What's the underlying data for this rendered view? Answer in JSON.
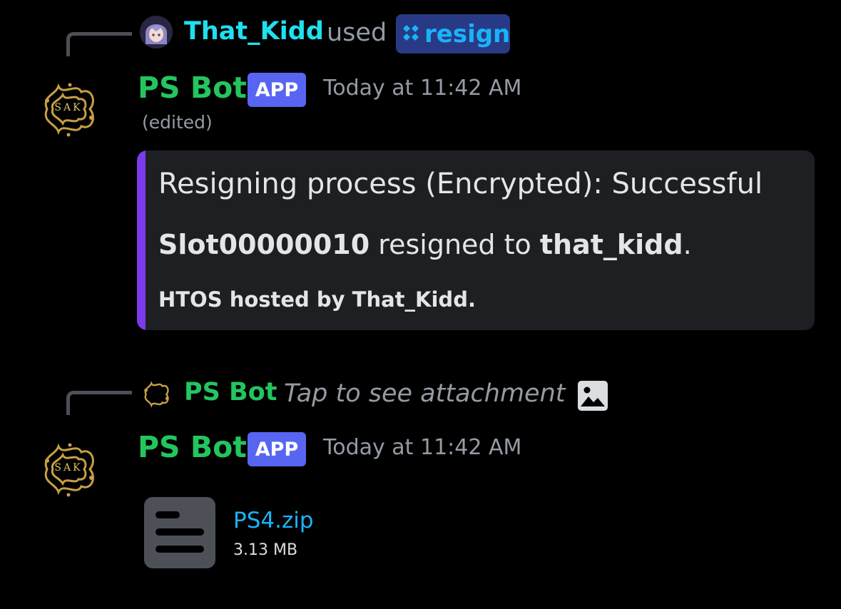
{
  "messages": [
    {
      "reply": {
        "username": "That_Kidd",
        "action": "used",
        "command": "resign"
      },
      "author": "PS Bot",
      "badge": "APP",
      "timestamp": "Today at 11:42 AM",
      "edited": "(edited)",
      "embed": {
        "title": "Resigning process (Encrypted): Successful",
        "slot": "Slot00000010",
        "resigned_to_text": "resigned to",
        "target": "that_kidd",
        "period": ".",
        "footer": "HTOS hosted by That_Kidd."
      }
    },
    {
      "reply": {
        "username": "PS Bot",
        "preview": "Tap to see attachment"
      },
      "author": "PS Bot",
      "badge": "APP",
      "timestamp": "Today at 11:42 AM",
      "attachment": {
        "filename": "PS4.zip",
        "size": "3.13 MB"
      }
    }
  ],
  "avatar_text": "SAK",
  "colors": {
    "cyan_username": "#1ee0ef",
    "bot_username": "#23c55e",
    "badge": "#5865f2",
    "embed_bar": "#7c3aed",
    "link": "#1ab3f7"
  }
}
